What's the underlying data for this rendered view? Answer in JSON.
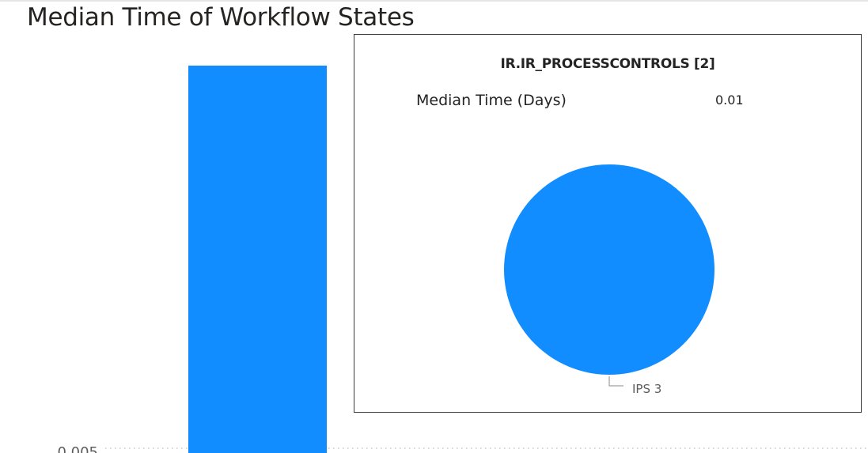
{
  "title": "Median Time of Workflow States",
  "colors": {
    "bar": "#118DFF",
    "grid": "#c8c8c8",
    "text": "#252423"
  },
  "chart_data": [
    {
      "type": "bar",
      "title": "Median Time of Workflow States",
      "y_ticks_visible": [
        "0.005"
      ],
      "values": [
        0.01
      ],
      "grid": true
    },
    {
      "type": "pie",
      "title": "IR.IR_PROCESSCONTROLS [2]",
      "measure_label": "Median Time (Days)",
      "measure_value": "0.01",
      "slices": [
        {
          "label": "IPS 3",
          "value": 0.01
        }
      ]
    }
  ]
}
